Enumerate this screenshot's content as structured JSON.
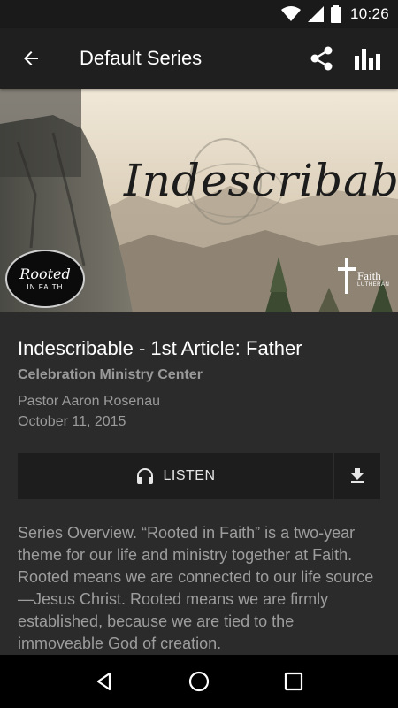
{
  "status_bar": {
    "time": "10:26",
    "icons": [
      "wifi-icon",
      "signal-icon",
      "battery-icon"
    ]
  },
  "app_bar": {
    "title": "Default Series",
    "back_icon": "arrow-back-icon",
    "actions": [
      "share-icon",
      "bar-chart-icon"
    ]
  },
  "hero": {
    "title": "Indescribable",
    "left_logo": {
      "line1": "Rooted",
      "line2": "IN FAITH"
    },
    "right_logo": {
      "name": "Faith",
      "sub": "LUTHERAN"
    }
  },
  "sermon": {
    "title": "Indescribable - 1st Article: Father",
    "location": "Celebration Ministry Center",
    "speaker": "Pastor Aaron Rosenau",
    "date": "October 11, 2015"
  },
  "actions": {
    "listen_label": "LISTEN",
    "listen_icon": "headphones-icon",
    "download_icon": "download-icon"
  },
  "overview": {
    "text": "Series Overview. “Rooted in Faith” is a two-year theme for our life and ministry together at Faith. Rooted means we are connected to our life source—Jesus Christ. Rooted means we are firmly established, because we are tied to the immoveable God of creation."
  },
  "nav_bar": {
    "buttons": [
      "back-triangle-icon",
      "home-circle-icon",
      "recents-square-icon"
    ]
  },
  "colors": {
    "background": "#2b2b2b",
    "app_bar": "#1f1f1f",
    "secondary_text": "#9a9a9a",
    "button_bg": "#1d1d1d"
  }
}
